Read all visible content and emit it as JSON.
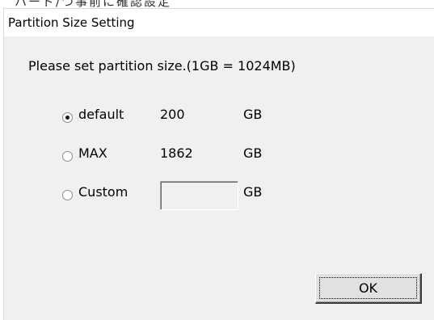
{
  "dialog": {
    "title": "Partition Size Setting",
    "prompt": "Please set partition size.(1GB = 1024MB)"
  },
  "options": [
    {
      "label": "default",
      "value": "200",
      "unit": "GB",
      "selected": true
    },
    {
      "label": "MAX",
      "value": "1862",
      "unit": "GB",
      "selected": false
    },
    {
      "label": "Custom",
      "value": "",
      "unit": "GB",
      "selected": false
    }
  ],
  "buttons": {
    "ok_label": "OK"
  },
  "residue": {
    "top_text": "ハード/つ事前に確認設定"
  }
}
